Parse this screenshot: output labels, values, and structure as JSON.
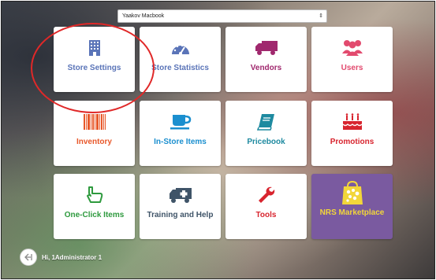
{
  "store_selector": {
    "value": "Yaakov Macbook"
  },
  "tiles": [
    {
      "label": "Store Settings",
      "icon": "building-icon",
      "color": "#5a74b8"
    },
    {
      "label": "Store Statistics",
      "icon": "gauge-icon",
      "color": "#5a74b8"
    },
    {
      "label": "Vendors",
      "icon": "truck-icon",
      "color": "#a0286e"
    },
    {
      "label": "Users",
      "icon": "users-icon",
      "color": "#e24a6e"
    },
    {
      "label": "Inventory",
      "icon": "barcode-icon",
      "color": "#e8582a"
    },
    {
      "label": "In-Store Items",
      "icon": "coffee-cup-icon",
      "color": "#1b8fcf"
    },
    {
      "label": "Pricebook",
      "icon": "book-icon",
      "color": "#1e8aa0"
    },
    {
      "label": "Promotions",
      "icon": "cake-icon",
      "color": "#d8242e"
    },
    {
      "label": "One-Click Items",
      "icon": "pointer-hand-icon",
      "color": "#2e9a3e"
    },
    {
      "label": "Training and Help",
      "icon": "ambulance-icon",
      "color": "#3f5468"
    },
    {
      "label": "Tools",
      "icon": "wrench-icon",
      "color": "#d8242e"
    },
    {
      "label": "NRS Marketplace",
      "icon": "shopping-bag-icon",
      "color": "#f2d63a"
    }
  ],
  "user": {
    "greeting": "Hi, 1Administrator 1"
  }
}
